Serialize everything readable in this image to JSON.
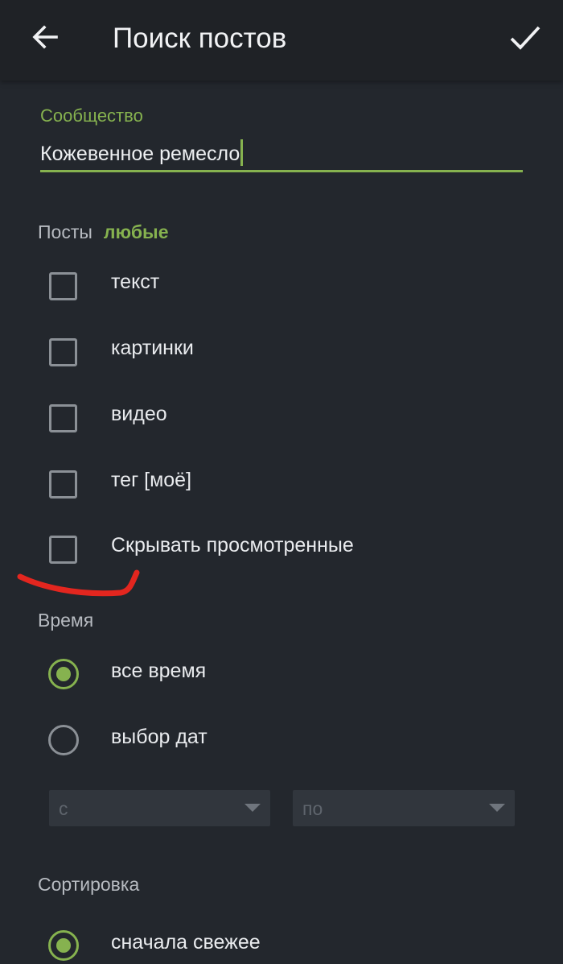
{
  "appbar": {
    "title": "Поиск постов",
    "back_icon": "arrow-left-icon",
    "confirm_icon": "check-icon"
  },
  "community": {
    "label": "Сообщество",
    "value": "Кожевенное ремесло"
  },
  "posts": {
    "label": "Посты",
    "filter": "любые",
    "options": [
      {
        "label": "текст",
        "checked": false
      },
      {
        "label": "картинки",
        "checked": false
      },
      {
        "label": "видео",
        "checked": false
      },
      {
        "label": "тег [моё]",
        "checked": false
      },
      {
        "label": "Скрывать просмотренные",
        "checked": false
      }
    ]
  },
  "time": {
    "label": "Время",
    "options": [
      {
        "label": "все время",
        "selected": true
      },
      {
        "label": "выбор дат",
        "selected": false
      }
    ],
    "from_placeholder": "с",
    "to_placeholder": "по"
  },
  "sort": {
    "label": "Сортировка",
    "options": [
      {
        "label": "сначала свежее",
        "selected": true
      }
    ]
  },
  "colors": {
    "accent": "#86b24f",
    "background": "#23272d",
    "annotation": "#e3261f"
  }
}
